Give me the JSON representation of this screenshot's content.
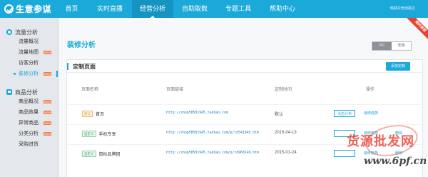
{
  "app": {
    "logo_text": "生意参谋"
  },
  "nav": {
    "items": [
      {
        "label": "首页",
        "active": false
      },
      {
        "label": "实时直播",
        "active": false
      },
      {
        "label": "经营分析",
        "active": true
      },
      {
        "label": "自助取数",
        "active": false
      },
      {
        "label": "专题工具",
        "active": false
      },
      {
        "label": "帮助中心",
        "active": false
      }
    ],
    "shop_link": "韩都衣舍旗舰店"
  },
  "sidebar": {
    "groups": [
      {
        "title": "流量分析",
        "items": [
          {
            "label": "流量概况",
            "new": false,
            "active": false
          },
          {
            "label": "流量地图",
            "new": true,
            "active": false
          },
          {
            "label": "访客分析",
            "new": false,
            "active": false
          },
          {
            "label": "装修分析",
            "new": true,
            "active": true
          }
        ]
      },
      {
        "title": "商品分析",
        "items": [
          {
            "label": "商品概况",
            "new": true,
            "active": false
          },
          {
            "label": "商品效果",
            "new": true,
            "active": false
          },
          {
            "label": "异常商品",
            "new": true,
            "active": false
          },
          {
            "label": "分类分析",
            "new": true,
            "active": false
          },
          {
            "label": "采购进货",
            "new": false,
            "active": false
          }
        ]
      }
    ],
    "new_badge": "NEW"
  },
  "main": {
    "title": "装修分析",
    "device_toggle": {
      "pc": "PC",
      "wireless": "无线",
      "selected": "PC"
    },
    "ribbon": "限时体验",
    "panel": {
      "title": "定制页面",
      "add_button": "添加定制",
      "columns": [
        "页面名称",
        "页面链接",
        "定制时间",
        "操作"
      ],
      "rows": [
        {
          "tag": "默认",
          "name": "首页",
          "link": "http://shop58501945.taobao.com",
          "time": "默认",
          "apply": "点击分布",
          "decorate": "装修趋势",
          "delete": ""
        },
        {
          "tag": "自定义",
          "name": "手机专享",
          "link": "http://shop58501945.taobao.com/p/rd541945.htm",
          "time": "2015-04-13",
          "apply": "",
          "decorate": "装修趋势",
          "delete": "删除"
        },
        {
          "tag": "自定义",
          "name": "鼠标品牌团",
          "link": "http://shop58501945.taobao.com/p/rd960149.htm",
          "time": "2015-01-24",
          "apply": "",
          "decorate": "装修趋势",
          "delete": "删除"
        }
      ]
    }
  },
  "watermark": {
    "text": "货源批发网",
    "url": "www.6pf.cn"
  }
}
